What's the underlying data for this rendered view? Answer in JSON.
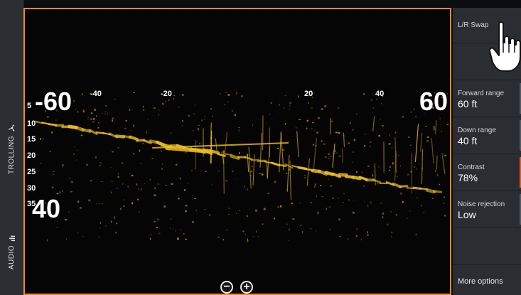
{
  "left_rail": {
    "trolling_label": "TROLLING",
    "audio_label": "AUDIO"
  },
  "sonar": {
    "forward_range_big": "60",
    "forward_range_big_left": "-60",
    "down_range_big": "40",
    "top_ticks": [
      "-40",
      "-20",
      "20",
      "40"
    ],
    "depth_ticks": [
      "5",
      "10",
      "15",
      "20",
      "25",
      "30",
      "35"
    ],
    "accent_color": "#e98c26",
    "echo_color": "#f2c21b",
    "zoom_out_symbol": "−",
    "zoom_in_symbol": "+"
  },
  "menu": {
    "lr_swap": "L/R Swap",
    "forward_range": {
      "label": "Forward range",
      "value": "60 ft"
    },
    "down_range": {
      "label": "Down range",
      "value": "40 ft"
    },
    "contrast": {
      "label": "Contrast",
      "value": "78%"
    },
    "noise_rejection": {
      "label": "Noise rejection",
      "value": "Low"
    },
    "more_options": "More options"
  }
}
